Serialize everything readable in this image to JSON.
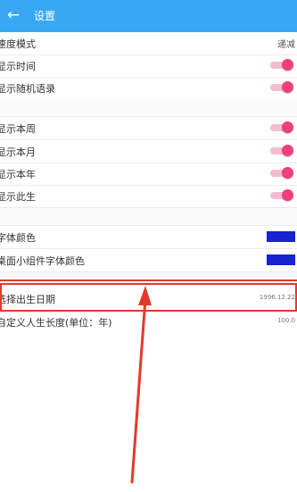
{
  "appbar": {
    "back_icon": "arrow-left-icon",
    "title": "设置"
  },
  "rows": {
    "speed_mode": {
      "label": "速度模式",
      "value": "递减"
    },
    "show_time": {
      "label": "显示时间",
      "on": true
    },
    "show_quote": {
      "label": "显示随机语录",
      "on": true
    },
    "show_week": {
      "label": "显示本周",
      "on": true
    },
    "show_month": {
      "label": "显示本月",
      "on": true
    },
    "show_year": {
      "label": "显示本年",
      "on": true
    },
    "show_life": {
      "label": "显示此生",
      "on": true
    },
    "font_color": {
      "label": "字体颜色",
      "color": "#1722d2"
    },
    "widget_font_color": {
      "label": "桌面小组件字体颜色",
      "color": "#1722d2"
    },
    "birth_date": {
      "label": "选择出生日期",
      "value": "1996.12.22"
    },
    "life_length": {
      "label": "自定义人生长度(单位：年)",
      "value": "100.0"
    }
  },
  "colors": {
    "appbar": "#3aa7f5",
    "toggle_thumb": "#ef3f7d",
    "toggle_track": "#f5bcd0",
    "annotation": "#e23a2a"
  }
}
